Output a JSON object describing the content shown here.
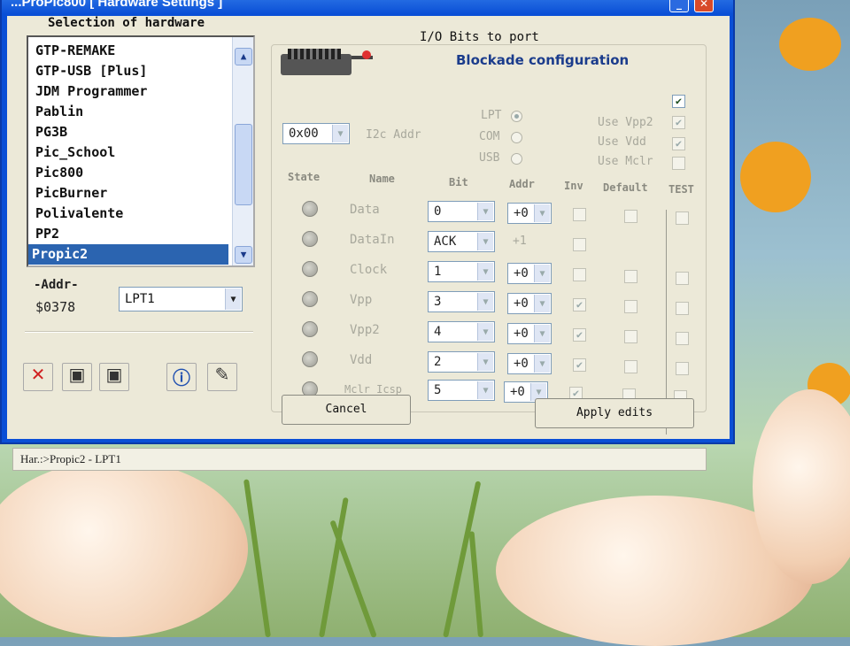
{
  "window": {
    "title": "...ProPic800 [ Hardware Settings ]",
    "minimize_icon": "minimize-icon",
    "maximize_icon": "maximize-icon",
    "close_icon": "close-icon"
  },
  "hardware": {
    "title": "Selection of hardware",
    "items": [
      {
        "label": "GTP-REMAKE"
      },
      {
        "label": "GTP-USB [Plus]"
      },
      {
        "label": "JDM Programmer"
      },
      {
        "label": "Pablin"
      },
      {
        "label": "PG3B"
      },
      {
        "label": "Pic_School"
      },
      {
        "label": "Pic800"
      },
      {
        "label": "PicBurner"
      },
      {
        "label": "Polivalente"
      },
      {
        "label": "PP2"
      },
      {
        "label": "Propic2"
      }
    ],
    "selected": "Propic2",
    "addr_label": "-Addr-",
    "addr_value": "$0378",
    "port_value": "LPT1"
  },
  "io": {
    "title": "I/O Bits to port",
    "blockade_title": "Blockade configuration",
    "blockade_checked": true,
    "i2c_value": "0x00",
    "i2c_label": "I2c Addr",
    "ports": [
      "LPT",
      "COM",
      "USB"
    ],
    "selected_port": "LPT",
    "options": [
      {
        "label": "Use Vpp2",
        "checked": true
      },
      {
        "label": "Use Vdd",
        "checked": true
      },
      {
        "label": "Use Mclr",
        "checked": false
      }
    ],
    "headers": {
      "state": "State",
      "name": "Name",
      "bit": "Bit",
      "addr": "Addr",
      "inv": "Inv",
      "default": "Default",
      "test": "TEST"
    },
    "rows": [
      {
        "name": "Data",
        "bit": "0",
        "addr": "+0",
        "addr_is_combo": true,
        "inv": false,
        "default": false,
        "test": false
      },
      {
        "name": "DataIn",
        "bit": "ACK",
        "addr": "+1",
        "addr_is_combo": false,
        "inv": false,
        "default": null,
        "test": null
      },
      {
        "name": "Clock",
        "bit": "1",
        "addr": "+0",
        "addr_is_combo": true,
        "inv": false,
        "default": false,
        "test": false
      },
      {
        "name": "Vpp",
        "bit": "3",
        "addr": "+0",
        "addr_is_combo": true,
        "inv": true,
        "default": false,
        "test": false
      },
      {
        "name": "Vpp2",
        "bit": "4",
        "addr": "+0",
        "addr_is_combo": true,
        "inv": true,
        "default": false,
        "test": false
      },
      {
        "name": "Vdd",
        "bit": "2",
        "addr": "+0",
        "addr_is_combo": true,
        "inv": true,
        "default": false,
        "test": false
      },
      {
        "name": "Mclr Icsp",
        "bit": "5",
        "addr": "+0",
        "addr_is_combo": true,
        "inv": true,
        "default": false,
        "test": false
      }
    ]
  },
  "buttons": {
    "cancel": "Cancel",
    "apply": "Apply edits"
  },
  "toolbar": [
    "delete-icon",
    "save-as-icon",
    "save-icon",
    "info-icon",
    "check-doc-icon"
  ],
  "status_text": "Har.:>Propic2 - LPT1"
}
